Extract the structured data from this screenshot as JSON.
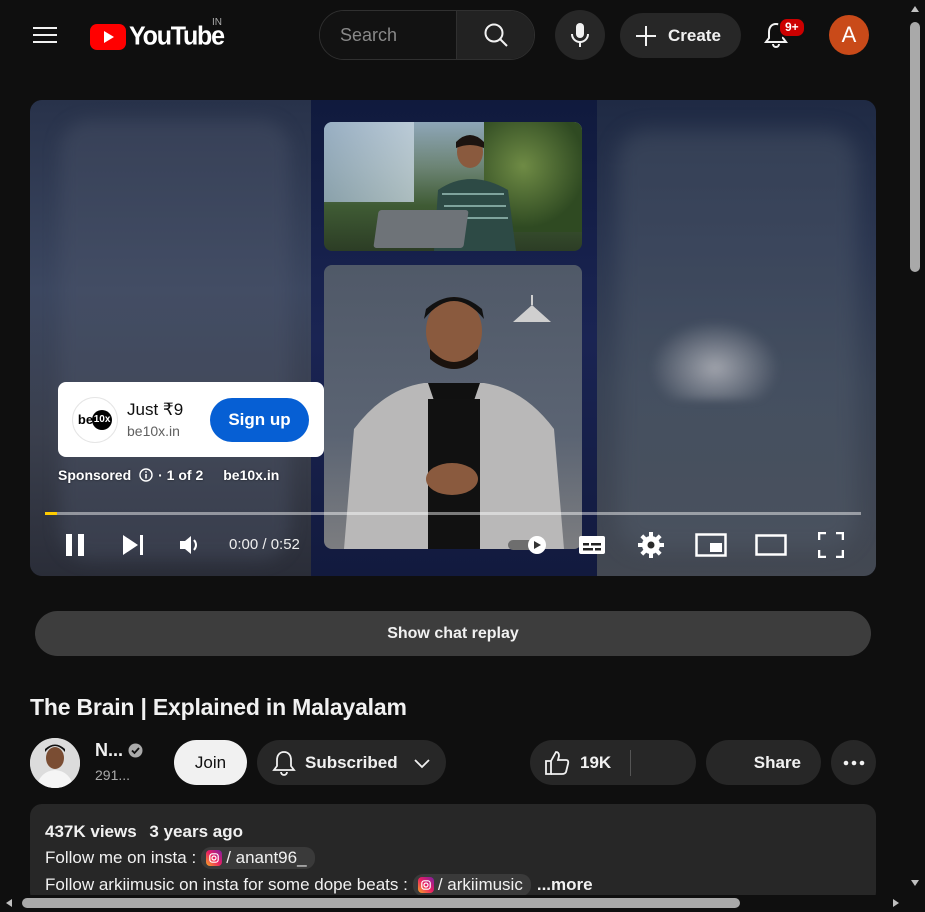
{
  "header": {
    "logo_text": "YouTube",
    "country_code": "IN",
    "search_placeholder": "Search",
    "create_label": "Create",
    "notification_count": "9+",
    "avatar_letter": "A"
  },
  "player": {
    "ad": {
      "title": "Just ₹9",
      "domain": "be10x.in",
      "cta_label": "Sign up",
      "logo_text": "be",
      "logo_badge": "10x",
      "sponsored_label": "Sponsored",
      "ad_count": "· 1 of 2",
      "advertiser": "be10x.in"
    },
    "time_display": "0:00 / 0:52",
    "progress_fraction": 0.015
  },
  "chat_replay_label": "Show chat replay",
  "video": {
    "title": "The Brain | Explained in Malayalam",
    "channel_name": "N...",
    "channel_subscribers": "291...",
    "join_label": "Join",
    "subscribed_label": "Subscribed",
    "like_count": "19K",
    "share_label": "Share"
  },
  "description": {
    "views": "437K views",
    "age": "3 years ago",
    "line1_text": "Follow me on insta :",
    "line1_chip": "/ anant96_",
    "line2_text": "Follow arkiimusic on insta for some dope beats :",
    "line2_chip": "/ arkiimusic",
    "more_label": "...more"
  },
  "colors": {
    "background": "#0f0f0f",
    "brand_red": "#ff0000",
    "cta_blue": "#065fd4",
    "progress_yellow": "#ffcc00",
    "avatar_orange": "#c94a19"
  }
}
